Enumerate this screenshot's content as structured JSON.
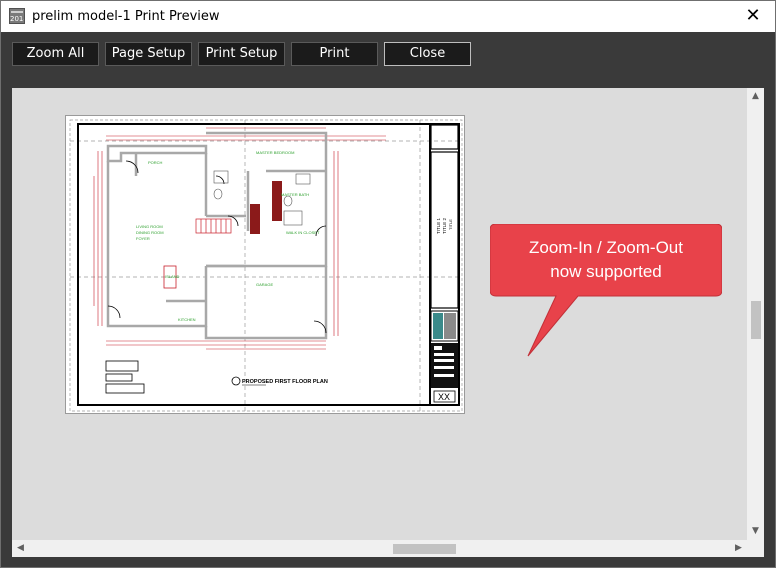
{
  "window": {
    "title": "prelim model-1 Print Preview",
    "icon": "app-icon",
    "icon_text": "2018"
  },
  "toolbar": {
    "buttons": [
      {
        "label": "Zoom All",
        "active": false
      },
      {
        "label": "Page Setup",
        "active": false
      },
      {
        "label": "Print Setup",
        "active": false
      },
      {
        "label": "Print",
        "active": false
      },
      {
        "label": "Close",
        "active": true
      }
    ]
  },
  "drawing": {
    "plan_title": "PROPOSED FIRST FLOOR PLAN",
    "rooms": {
      "porch": "PORCH",
      "master_bedroom": "MASTER BEDROOM",
      "master_bath": "MASTER BATH",
      "living_room": "LIVING ROOM",
      "dining_room": "DINING ROOM",
      "foyer": "FOYER",
      "garage": "GARAGE",
      "kitchen": "KITCHEN",
      "walk_in_closet": "WALK IN CLOSET",
      "island": "ISLAND"
    },
    "title_block": {
      "title_1": "TITLE 1",
      "title_2": "TITLE 2",
      "title_3": "TITLE",
      "sheet": "XX"
    }
  },
  "callout": {
    "line1": "Zoom-In / Zoom-Out",
    "line2": "now supported",
    "color": "#e8424a"
  },
  "colors": {
    "toolbar_bg": "#3a3a3a",
    "button_bg": "#1b1b1b",
    "viewport_bg": "#dcdcdc",
    "dimension_red": "#c8202c",
    "room_label_green": "#2ea02e"
  }
}
